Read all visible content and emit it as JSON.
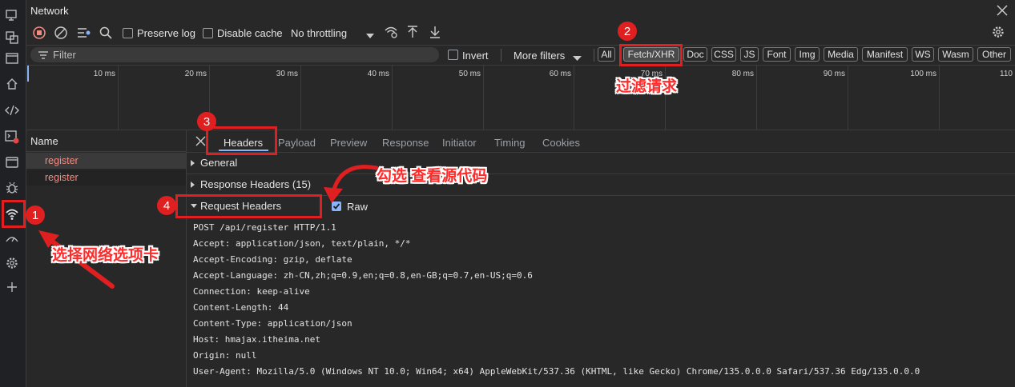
{
  "window": {
    "title": "Network"
  },
  "toolbar": {
    "preserve_log": "Preserve log",
    "disable_cache": "Disable cache",
    "throttling": "No throttling"
  },
  "filterbar": {
    "placeholder": "Filter",
    "invert": "Invert",
    "more_filters": "More filters",
    "types": [
      "All",
      "Fetch/XHR",
      "Doc",
      "CSS",
      "JS",
      "Font",
      "Img",
      "Media",
      "Manifest",
      "WS",
      "Wasm",
      "Other"
    ],
    "selected_type": "Fetch/XHR"
  },
  "timeline": {
    "ticks": [
      "10 ms",
      "20 ms",
      "30 ms",
      "40 ms",
      "50 ms",
      "60 ms",
      "70 ms",
      "80 ms",
      "90 ms",
      "100 ms",
      "110"
    ]
  },
  "requests": {
    "column_header": "Name",
    "rows": [
      "register",
      "register"
    ]
  },
  "details": {
    "tabs": [
      "Headers",
      "Payload",
      "Preview",
      "Response",
      "Initiator",
      "Timing",
      "Cookies"
    ],
    "active_tab": "Headers",
    "sections": {
      "general": "General",
      "response_headers": "Response Headers (15)",
      "request_headers": "Request Headers",
      "raw": "Raw"
    },
    "raw_request_lines": [
      "POST /api/register HTTP/1.1",
      "Accept: application/json, text/plain, */*",
      "Accept-Encoding: gzip, deflate",
      "Accept-Language: zh-CN,zh;q=0.9,en;q=0.8,en-GB;q=0.7,en-US;q=0.6",
      "Connection: keep-alive",
      "Content-Length: 44",
      "Content-Type: application/json",
      "Host: hmajax.itheima.net",
      "Origin: null",
      "User-Agent: Mozilla/5.0 (Windows NT 10.0; Win64; x64) AppleWebKit/537.36 (KHTML, like Gecko) Chrome/135.0.0.0 Safari/537.36 Edg/135.0.0.0"
    ]
  },
  "annotations": {
    "badges": [
      "1",
      "2",
      "3",
      "4"
    ],
    "select_network_tab": "选择网络选项卡",
    "filter_requests": "过滤请求",
    "check_view_source": "勾选 查看源代码"
  },
  "colors": {
    "accent": "#e02020",
    "request_name": "#f28b82",
    "link_blue": "#8ab4f8"
  }
}
